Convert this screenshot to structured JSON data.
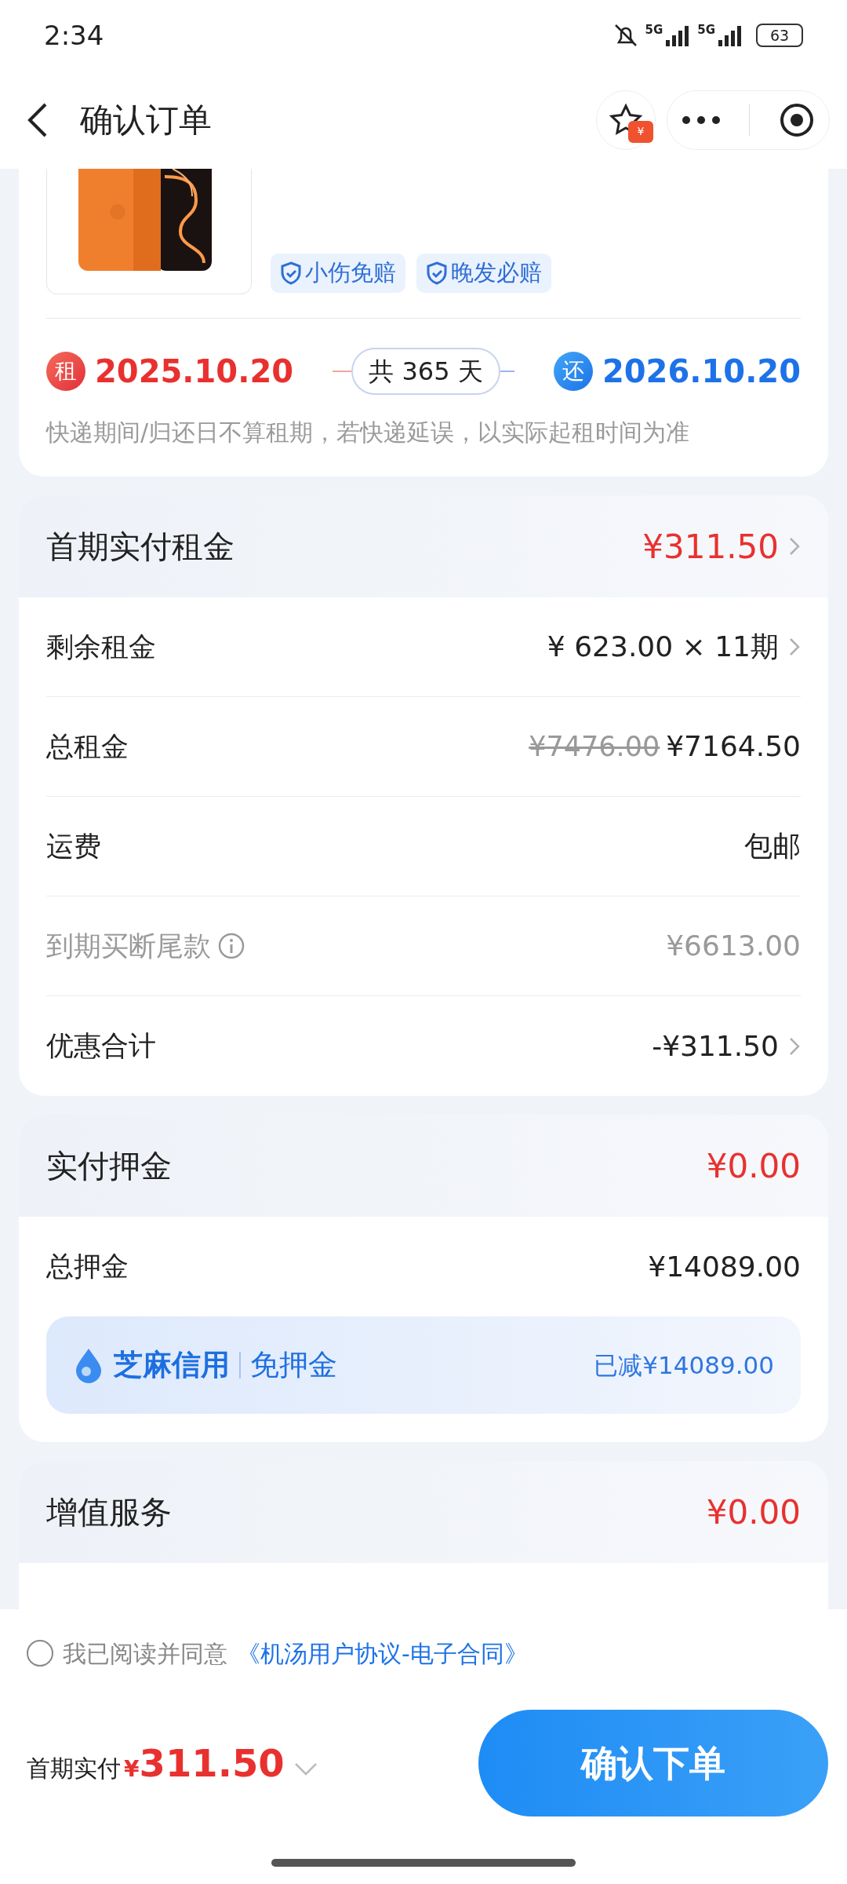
{
  "status_bar": {
    "time": "2:34",
    "network_1": "5G",
    "network_2": "5G",
    "battery": "63"
  },
  "header": {
    "title": "确认订单",
    "favorite_badge": "¥"
  },
  "product": {
    "tags": [
      "小伤免赔",
      "晚发必赔"
    ]
  },
  "rental_period": {
    "start_badge": "租",
    "start": "2025.10.20",
    "duration": "共 365 天",
    "end_badge": "还",
    "end": "2026.10.20",
    "note": "快递期间/归还日不算租期，若快递延误，以实际起租时间为准"
  },
  "rent": {
    "title": "首期实付租金",
    "amount": "¥311.50",
    "rows": [
      {
        "kind": "link",
        "label": "剩余租金",
        "value": "¥ 623.00 × 11期"
      },
      {
        "kind": "price",
        "label": "总租金",
        "original": "¥7476.00",
        "value": "¥7164.50"
      },
      {
        "kind": "plain",
        "label": "运费",
        "value": "包邮"
      },
      {
        "kind": "muted",
        "label": "到期买断尾款",
        "value": "¥6613.00"
      },
      {
        "kind": "link",
        "label": "优惠合计",
        "value": "-¥311.50"
      }
    ]
  },
  "deposit": {
    "title": "实付押金",
    "amount": "¥0.00",
    "rows": [
      {
        "kind": "plain",
        "label": "总押金",
        "value": "¥14089.00"
      }
    ],
    "credit": {
      "brand": "芝麻信用",
      "label": "免押金",
      "reduced": "已减¥14089.00"
    }
  },
  "value_added": {
    "title": "增值服务",
    "amount": "¥0.00"
  },
  "agreement": {
    "checked": false,
    "text": "我已阅读并同意",
    "link": "《机汤用户协议-电子合同》"
  },
  "footer": {
    "label": "首期实付",
    "currency": "¥",
    "amount": "311.50",
    "button": "确认下单"
  }
}
